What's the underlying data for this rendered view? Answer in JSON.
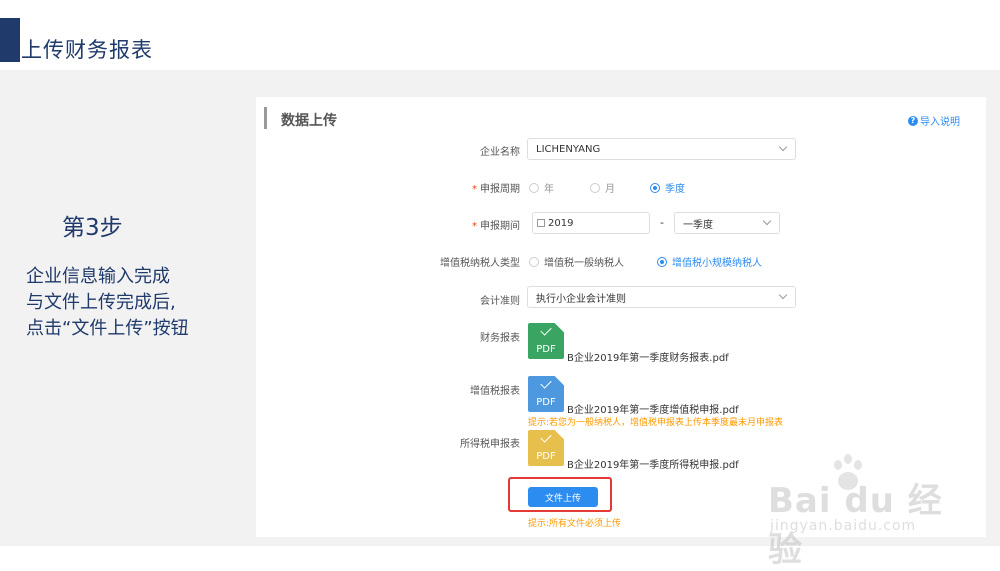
{
  "slide": {
    "title": "上传财务报表",
    "step": "第3步",
    "desc": [
      "企业信息输入完成",
      "与文件上传完成后,",
      "点击“文件上传”按钮"
    ]
  },
  "panel": {
    "title": "数据上传",
    "help_label": "导入说明",
    "company_label": "企业名称",
    "company_value": "LICHENYANG",
    "period_label": "申报周期",
    "period_options": [
      "年",
      "月",
      "季度"
    ],
    "period_selected": "季度",
    "range_label": "申报期间",
    "range_year": "2019",
    "range_dash": "-",
    "range_quarter": "一季度",
    "taxpayer_label": "增值税纳税人类型",
    "taxpayer_options": [
      "增值税一般纳税人",
      "增值税小规模纳税人"
    ],
    "taxpayer_selected": "增值税小规模纳税人",
    "std_label": "会计准则",
    "std_value": "执行小企业会计准则",
    "fin_label": "财务报表",
    "fin_file": "B企业2019年第一季度财务报表.pdf",
    "vat_label": "增值税报表",
    "vat_file": "B企业2019年第一季度增值税申报.pdf",
    "vat_hint": "提示:若您为一般纳税人，增值税申报表上传本季度最末月申报表",
    "income_label": "所得税申报表",
    "income_file": "B企业2019年第一季度所得税申报.pdf",
    "pdf_text": "PDF",
    "upload_button": "文件上传",
    "upload_hint": "提示:所有文件必须上传"
  },
  "colors": {
    "primary": "#2d8cf0",
    "title_navy": "#1f3a6b",
    "pdf_green": "#3aa563",
    "pdf_blue": "#4d98de",
    "pdf_yellow": "#e6bf4c",
    "hint_orange": "#ff9900",
    "highlight_red": "#e53935"
  },
  "watermark": {
    "brand": "Bai du 经验",
    "url": "jingyan.baidu.com"
  }
}
